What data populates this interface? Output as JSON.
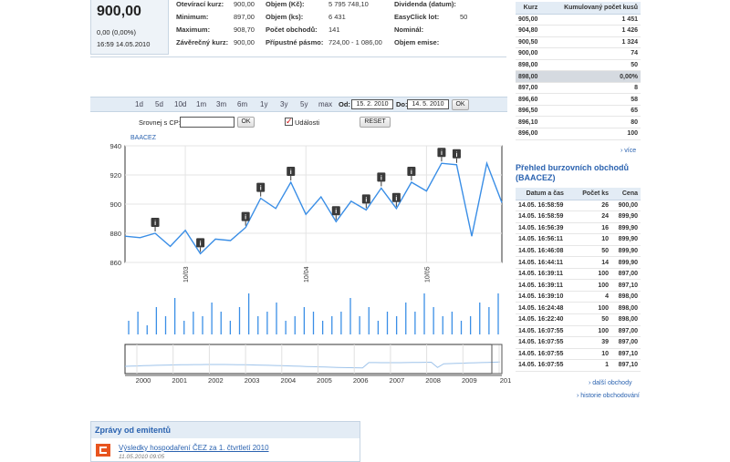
{
  "quote": {
    "price": "900,00",
    "change": "0,00 (0,00%)",
    "time": "16:59 14.05.2010"
  },
  "stats": [
    {
      "label": "Otevírací kurz:",
      "value": "900,00"
    },
    {
      "label": "Minimum:",
      "value": "897,00"
    },
    {
      "label": "Maximum:",
      "value": "908,70"
    },
    {
      "label": "Závěrečný kurz:",
      "value": "900,00"
    },
    {
      "label": "Objem (Kč):",
      "value": "5 795 748,10"
    },
    {
      "label": "Objem (ks):",
      "value": "6 431"
    },
    {
      "label": "Počet obchodů:",
      "value": "141"
    },
    {
      "label": "Přípustné pásmo:",
      "value": "724,00 - 1 086,00"
    },
    {
      "label": "Dividenda (datum):",
      "value": ""
    },
    {
      "label": "EasyClick lot:",
      "value": "50"
    },
    {
      "label": "Nominál:",
      "value": ""
    },
    {
      "label": "Objem emise:",
      "value": ""
    }
  ],
  "toolbar": {
    "periods": [
      "1d",
      "5d",
      "10d",
      "1m",
      "3m",
      "6m",
      "1y",
      "3y",
      "5y",
      "max"
    ],
    "from_label": "Od:",
    "from_value": "15. 2. 2010",
    "to_label": "Do:",
    "to_value": "14. 5. 2010",
    "ok_label": "OK",
    "compare_label": "Srovnej s CP:",
    "compare_ok": "OK",
    "events_label": "Události",
    "reset_label": "RESET"
  },
  "ticker_link": "BAACEZ",
  "cumulative": {
    "headers": [
      "Kurz",
      "Kumulovaný počet kusů"
    ],
    "rows": [
      [
        "905,00",
        "1 451"
      ],
      [
        "904,80",
        "1 426"
      ],
      [
        "900,50",
        "1 324"
      ],
      [
        "900,00",
        "74"
      ],
      [
        "898,00",
        "50"
      ],
      [
        "898,00",
        "0,00%"
      ],
      [
        "897,00",
        "8"
      ],
      [
        "896,60",
        "58"
      ],
      [
        "896,50",
        "65"
      ],
      [
        "896,10",
        "80"
      ],
      [
        "896,00",
        "100"
      ]
    ],
    "highlight_row": 5,
    "more": "› více"
  },
  "trades": {
    "title": "Přehled burzovních obchodů (BAACEZ)",
    "headers": [
      "Datum a čas",
      "Počet ks",
      "Cena"
    ],
    "rows": [
      [
        "14.05. 16:58:59",
        "26",
        "900,00"
      ],
      [
        "14.05. 16:58:59",
        "24",
        "899,90"
      ],
      [
        "14.05. 16:56:39",
        "16",
        "899,90"
      ],
      [
        "14.05. 16:56:11",
        "10",
        "899,90"
      ],
      [
        "14.05. 16:46:08",
        "50",
        "899,90"
      ],
      [
        "14.05. 16:44:11",
        "14",
        "899,90"
      ],
      [
        "14.05. 16:39:11",
        "100",
        "897,00"
      ],
      [
        "14.05. 16:39:11",
        "100",
        "897,10"
      ],
      [
        "14.05. 16:39:10",
        "4",
        "898,00"
      ],
      [
        "14.05. 16:24:48",
        "100",
        "898,00"
      ],
      [
        "14.05. 16:22:40",
        "50",
        "898,00"
      ],
      [
        "14.05. 16:07:55",
        "100",
        "897,00"
      ],
      [
        "14.05. 16:07:55",
        "39",
        "897,00"
      ],
      [
        "14.05. 16:07:55",
        "10",
        "897,10"
      ],
      [
        "14.05. 16:07:55",
        "1",
        "897,10"
      ]
    ],
    "more": "› další obchody",
    "history": "› historie obchodování"
  },
  "news": {
    "title": "Zprávy od emitentů",
    "headline": "Výsledky hospodaření ČEZ za 1. čtvrtletí 2010",
    "date": "11.05.2010 09:05"
  },
  "chart_data": {
    "type": "line",
    "x": [
      "15.2.",
      "18.2.",
      "22.2.",
      "25.2.",
      "1.3.",
      "4.3.",
      "8.3.",
      "11.3.",
      "15.3.",
      "18.3.",
      "22.3.",
      "25.3.",
      "29.3.",
      "1.4.",
      "6.4.",
      "9.4.",
      "13.4.",
      "16.4.",
      "20.4.",
      "23.4.",
      "27.4.",
      "30.4.",
      "4.5.",
      "7.5.",
      "11.5.",
      "14.5."
    ],
    "y": [
      878,
      877,
      880,
      871,
      882,
      866,
      876,
      875,
      884,
      904,
      897,
      915,
      893,
      905,
      888,
      902,
      896,
      911,
      897,
      915,
      909,
      928,
      927,
      878,
      928,
      901
    ],
    "ylim": [
      860,
      940
    ],
    "yticks": [
      860,
      880,
      900,
      920,
      940
    ],
    "xticks": [
      "10/03",
      "10/04",
      "10/05"
    ],
    "event_markers": 12,
    "volume": [
      3,
      5,
      2,
      6,
      4,
      8,
      3,
      5,
      4,
      7,
      5,
      3,
      6,
      9,
      4,
      5,
      7,
      3,
      4,
      6,
      5,
      3,
      4,
      5,
      8,
      4,
      6,
      3,
      5,
      4,
      7,
      5,
      9,
      6,
      4,
      5,
      3,
      4,
      7,
      6,
      9
    ],
    "navigator_years": [
      "2000",
      "2001",
      "2002",
      "2003",
      "2004",
      "2005",
      "2006",
      "2007",
      "2008",
      "2009",
      "201"
    ],
    "line_color": "#3a8ee6"
  }
}
